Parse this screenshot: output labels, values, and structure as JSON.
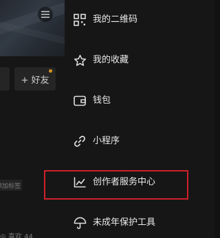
{
  "left": {
    "add_friend_label": "+ 好友",
    "tag_text": "添加标签",
    "bottom_text": "◎ 喜欢 44"
  },
  "drawer": {
    "items": [
      {
        "label": "我的二维码",
        "icon": "qr-code-icon"
      },
      {
        "label": "我的收藏",
        "icon": "star-icon"
      },
      {
        "label": "钱包",
        "icon": "wallet-icon"
      },
      {
        "label": "小程序",
        "icon": "link-icon"
      },
      {
        "label": "创作者服务中心",
        "icon": "chart-icon"
      },
      {
        "label": "未成年保护工具",
        "icon": "umbrella-icon"
      }
    ]
  },
  "colors": {
    "highlight": "#d0202a",
    "drawer_bg": "#161616",
    "notification_dot": "#f5a623"
  }
}
